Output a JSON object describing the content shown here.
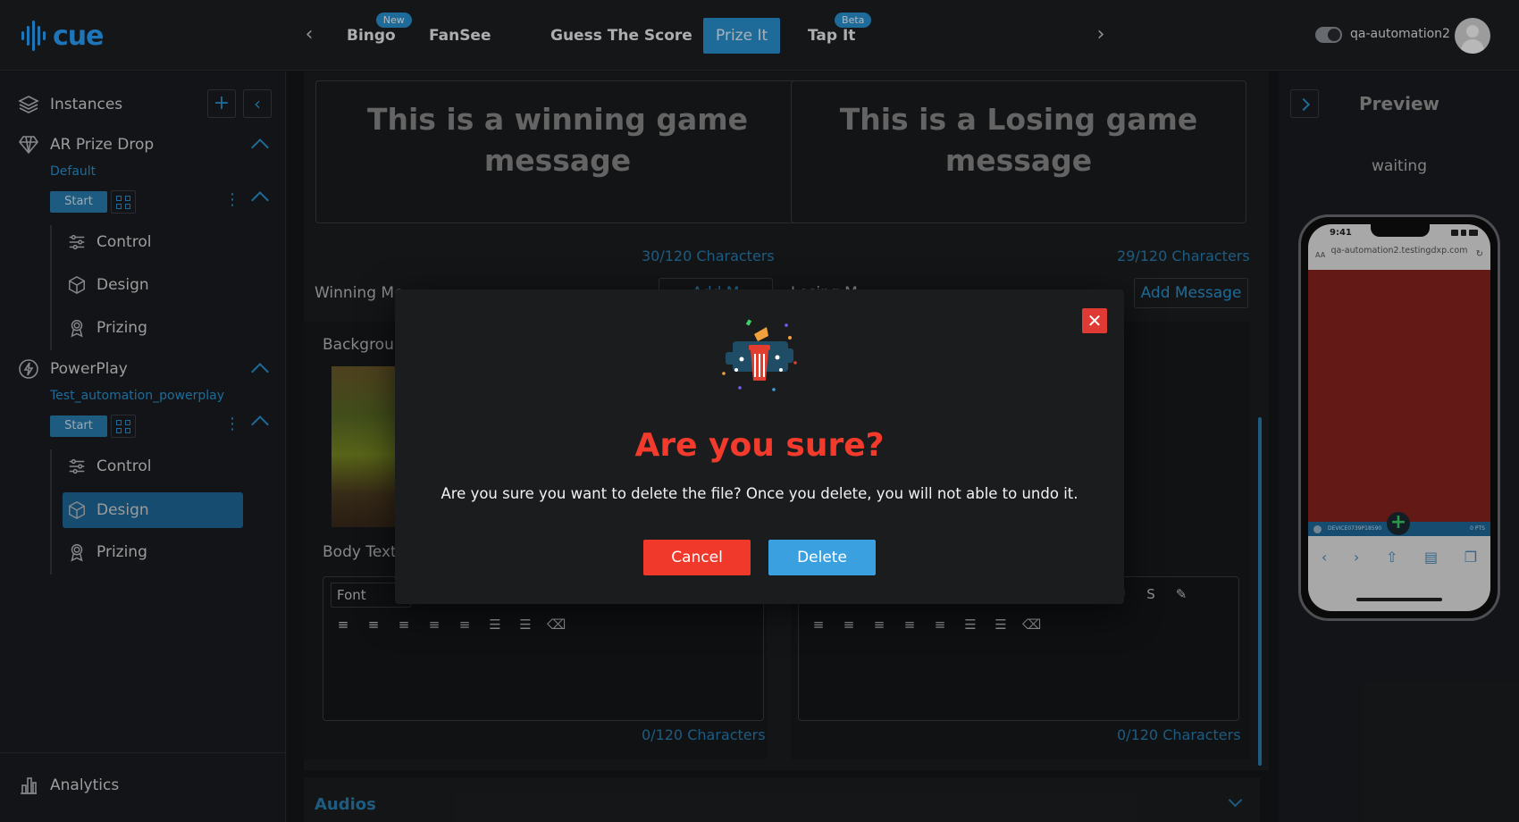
{
  "app": {
    "logo": "cue",
    "user_name": "qa-automation2"
  },
  "colors": {
    "accent": "#2a95d4",
    "danger": "#f0392b",
    "brand": "#2aa3ff"
  },
  "nav": {
    "tabs": [
      {
        "label": "Bingo",
        "badge": "New"
      },
      {
        "label": "FanSee"
      },
      {
        "label": "Guess The Score"
      },
      {
        "label": "Prize It",
        "active": true
      },
      {
        "label": "Tap It",
        "badge": "Beta"
      }
    ]
  },
  "sidebar": {
    "instances_label": "Instances",
    "groups": [
      {
        "title": "AR Prize Drop",
        "subtitle": "Default",
        "start_label": "Start",
        "items": [
          "Control",
          "Design",
          "Prizing"
        ]
      },
      {
        "title": "PowerPlay",
        "subtitle": "Test_automation_powerplay",
        "start_label": "Start",
        "items": [
          "Control",
          "Design",
          "Prizing"
        ],
        "active_item": "Design"
      }
    ],
    "analytics_label": "Analytics"
  },
  "main": {
    "winning_message": "This is a winning game message",
    "losing_message": "This is a Losing game message",
    "winning_count": "30/120 Characters",
    "losing_count": "29/120 Characters",
    "winning_label": "Winning Me",
    "losing_label": "Losing M",
    "add_message_label": "Add Message",
    "add_message_obscured": "Add M",
    "background_label": "Backgrour",
    "body_text_label": "Body Text",
    "font_placeholder": "Font",
    "body_count_left": "0/120 Characters",
    "body_count_right": "0/120 Characters",
    "audios_label": "Audios"
  },
  "preview": {
    "title": "Preview",
    "status": "waiting",
    "phone_time": "9:41",
    "phone_url": "qa-automation2.testingdxp.com",
    "phone_aa": "AA",
    "phone_footer_id": "DEVICE0739P18590",
    "phone_footer_pts": "0 PTS"
  },
  "modal": {
    "title": "Are you sure?",
    "message": "Are you sure you want to delete the file? Once you delete, you will not able to undo it.",
    "cancel_label": "Cancel",
    "delete_label": "Delete"
  }
}
